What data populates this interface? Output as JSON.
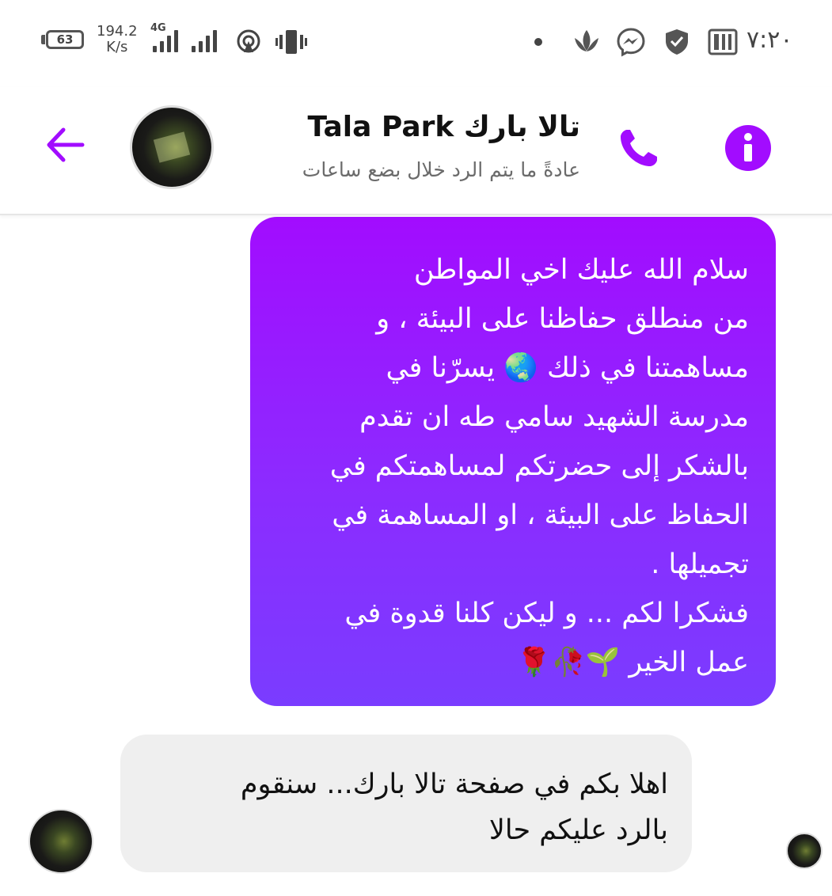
{
  "status_bar": {
    "battery": "63",
    "speed_value": "194.2",
    "speed_unit": "K/s",
    "network_type": "4G",
    "time": "٧:٢٠",
    "icons": [
      "battery-icon",
      "signal-icon",
      "hotspot-icon",
      "vibrate-icon",
      "notification-dot-icon",
      "lotus-icon",
      "messenger-icon",
      "shield-icon",
      "parking-app-icon"
    ]
  },
  "header": {
    "contact_name": "تالا بارك Tala Park",
    "contact_status": "عادةً ما يتم الرد خلال بضع ساعات",
    "accent_color": "#a20cff",
    "icons": [
      "back-arrow-icon",
      "avatar",
      "phone-icon",
      "info-icon"
    ]
  },
  "messages": [
    {
      "direction": "outgoing",
      "text": "سلام الله عليك اخي المواطن\nمن منطلق حفاظنا على البيئة ، و\nمساهمتنا في ذلك 🌏 يسرّنا في\nمدرسة الشهيد سامي طه ان تقدم\nبالشكر إلى حضرتكم لمساهمتكم في\nالحفاظ على البيئة ، او المساهمة في\nتجميلها .\nفشكرا لكم ... و ليكن كلنا قدوة في\nعمل الخير 🌱🥀🌹"
    },
    {
      "direction": "incoming",
      "text": "اهلا بكم في صفحة تالا بارك... سنقوم\nبالرد عليكم حالا"
    }
  ]
}
